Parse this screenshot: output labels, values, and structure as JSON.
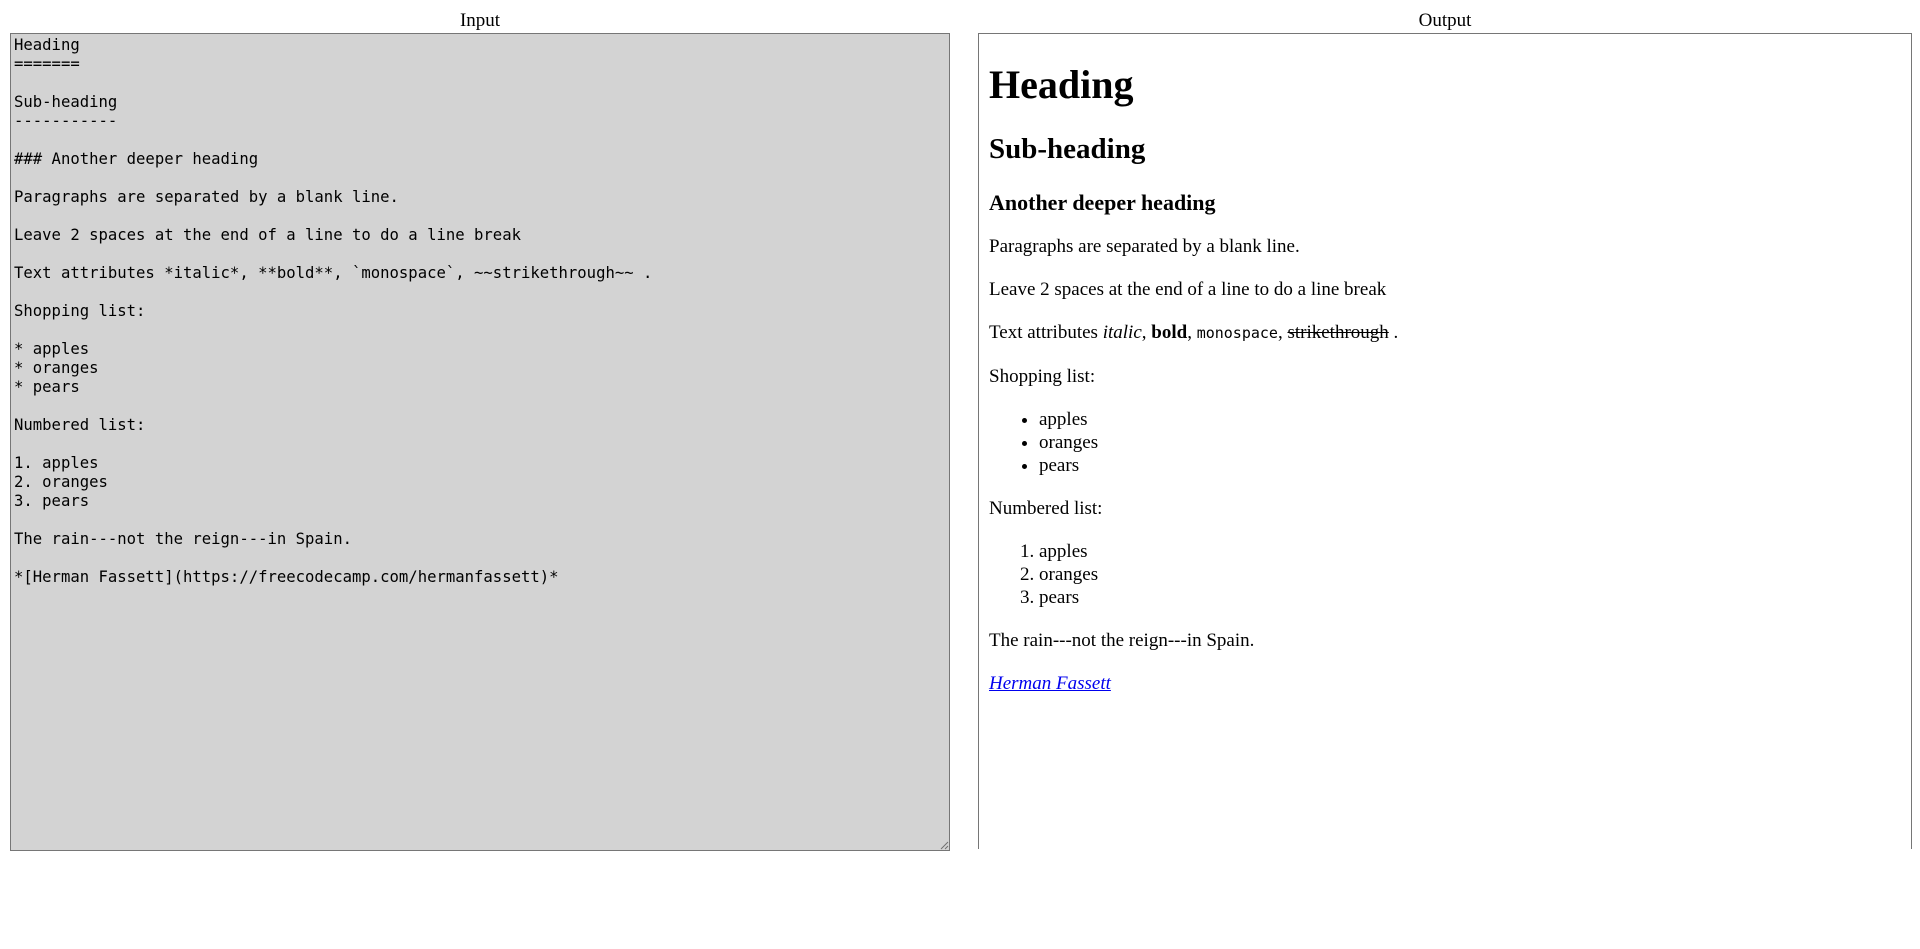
{
  "panes": {
    "input_title": "Input",
    "output_title": "Output"
  },
  "editor": {
    "value": "Heading\n=======\n\nSub-heading\n-----------\n\n### Another deeper heading\n\nParagraphs are separated by a blank line.\n\nLeave 2 spaces at the end of a line to do a line break\n\nText attributes *italic*, **bold**, `monospace`, ~~strikethrough~~ .\n\nShopping list:\n\n* apples\n* oranges\n* pears\n\nNumbered list:\n\n1. apples\n2. oranges\n3. pears\n\nThe rain---not the reign---in Spain.\n\n*[Herman Fassett](https://freecodecamp.com/hermanfassett)*"
  },
  "preview": {
    "h1": "Heading",
    "h2": "Sub-heading",
    "h3": "Another deeper heading",
    "p1": "Paragraphs are separated by a blank line.",
    "p2": "Leave 2 spaces at the end of a line to do a line break",
    "attrs": {
      "prefix": "Text attributes ",
      "italic": "italic",
      "sep1": ", ",
      "bold": "bold",
      "sep2": ", ",
      "mono": "monospace",
      "sep3": ", ",
      "strike": "strikethrough",
      "suffix": " ."
    },
    "shopping_label": "Shopping list:",
    "shopping_items": [
      "apples",
      "oranges",
      "pears"
    ],
    "numbered_label": "Numbered list:",
    "numbered_items": [
      "apples",
      "oranges",
      "pears"
    ],
    "rain": "The rain---not the reign---in Spain.",
    "link": {
      "text": "Herman Fassett",
      "href": "https://freecodecamp.com/hermanfassett"
    }
  }
}
